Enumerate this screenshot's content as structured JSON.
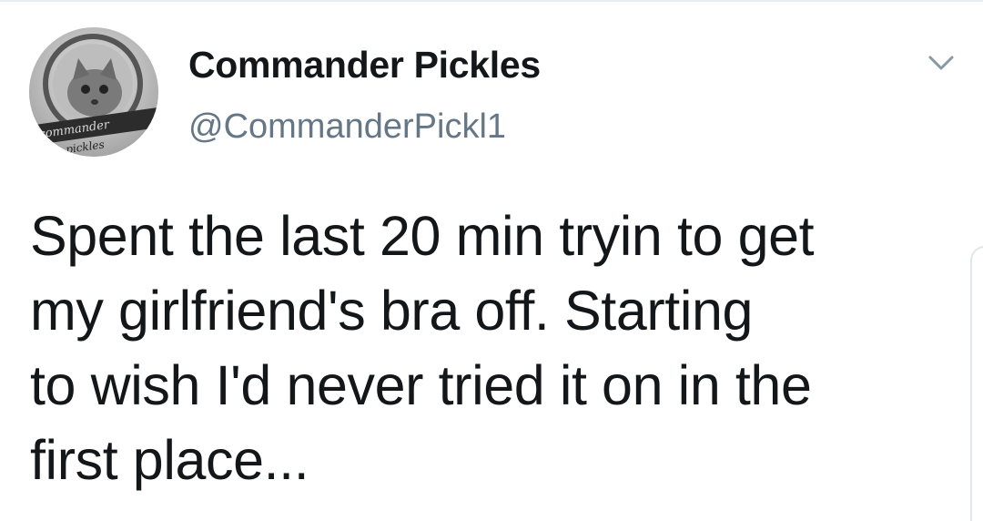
{
  "tweet": {
    "author": {
      "display_name": "Commander Pickles",
      "handle": "@CommanderPickl1",
      "avatar_text_line1": "commander",
      "avatar_text_line2": "pickles"
    },
    "text": "Spent the last 20 min tryin to get\nmy girlfriend's bra off. Starting\nto wish I'd never tried it on in the\nfirst place...",
    "menu_icon": "chevron-down-icon"
  },
  "colors": {
    "text_primary": "#14171a",
    "text_secondary": "#657786",
    "divider": "#e6ecf0"
  }
}
